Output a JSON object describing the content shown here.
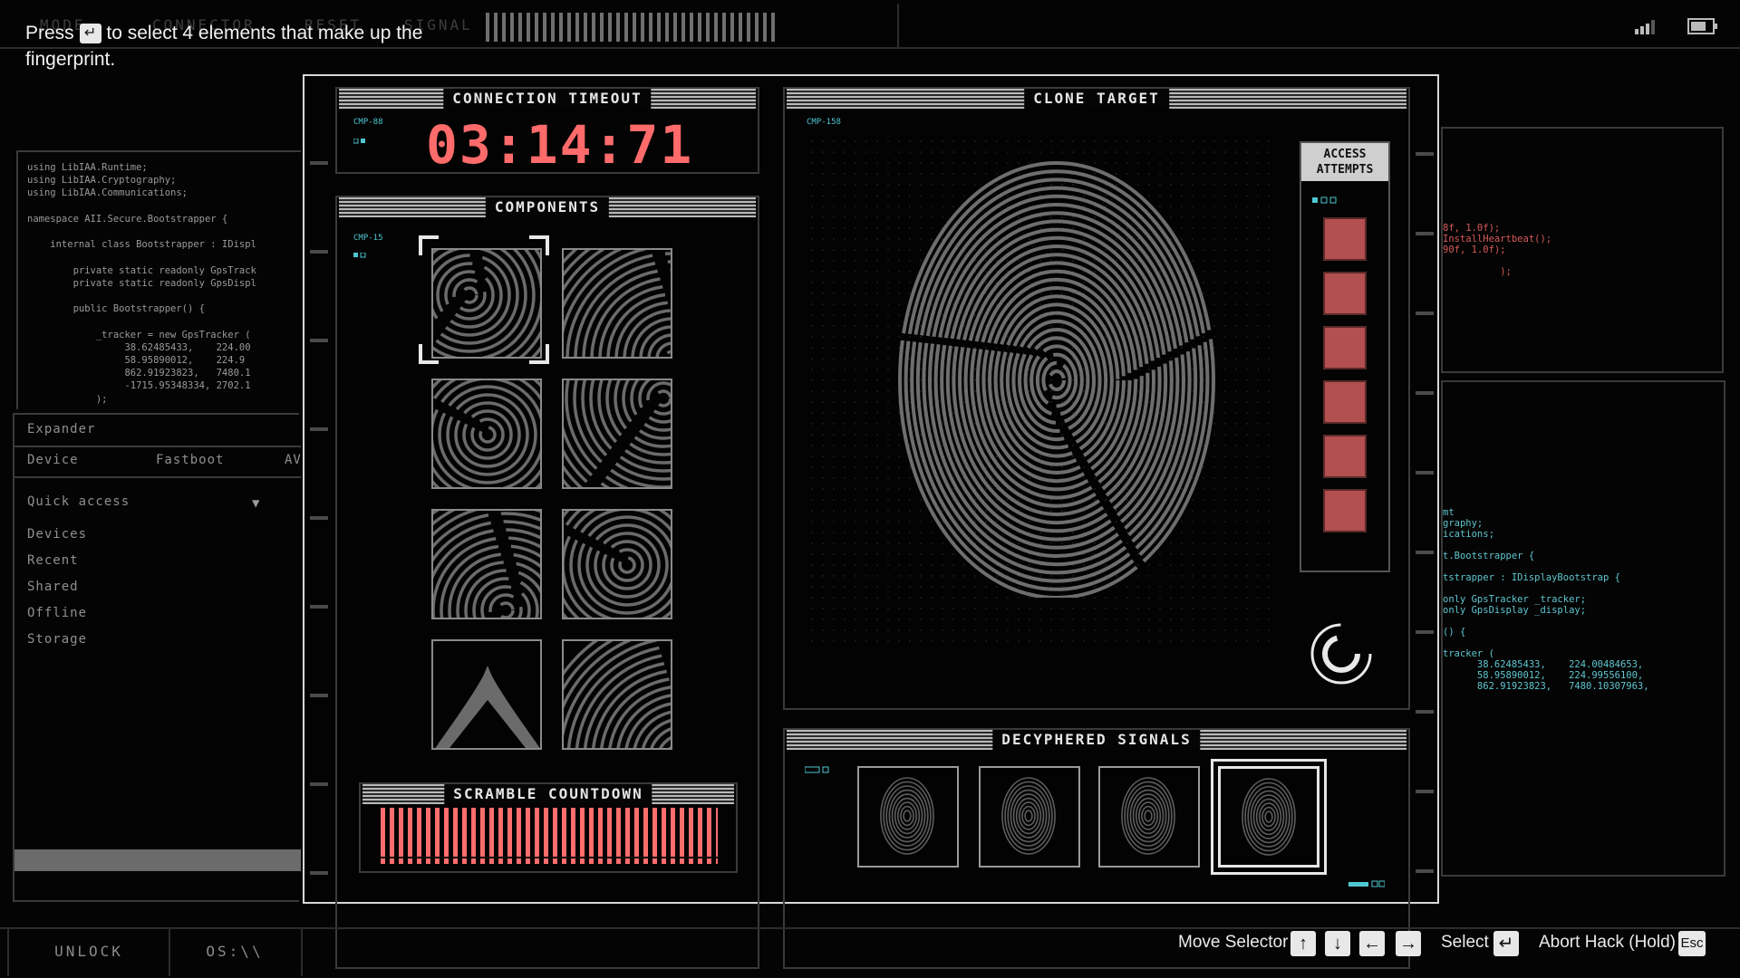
{
  "hint": {
    "prefix": "Press",
    "suffix": "to select 4 elements that make up the fingerprint."
  },
  "top_tabs": [
    "MODE",
    "CONNECTOR",
    "RESET",
    "SIGNAL"
  ],
  "code_left": "using LibIAA.Runtime;\nusing LibIAA.Cryptography;\nusing LibIAA.Communications;\n\nnamespace AII.Secure.Bootstrapper {\n\n    internal class Bootstrapper : IDispl\n\n        private static readonly GpsTrack\n        private static readonly GpsDispl\n\n        public Bootstrapper() {\n\n            _tracker = new GpsTracker (\n                 38.62485433,    224.00\n                 58.95890012,    224.9\n                 862.91923823,   7480.1\n                 -1715.95348334, 2702.1\n            );",
  "explorer": {
    "title": "Expander",
    "cols": [
      "Device",
      "Fastboot",
      "AV"
    ],
    "quick_access": "Quick access",
    "items": [
      "Devices",
      "Recent",
      "Shared",
      "Offline",
      "Storage"
    ]
  },
  "code_right_top": "8f, 1.0f);\nInstallHeartbeat();\n90f, 1.0f);\n\n          );",
  "code_right_bottom": "mt\ngraphy;\nications;\n\nt.Bootstrapper {\n\ntstrapper : IDisplayBootstrap {\n\nonly GpsTracker _tracker;\nonly GpsDisplay _display;\n\n() {\n\ntracker (\n      38.62485433,    224.00484653,\n      58.95890012,    224.99556100,\n      862.91923823,   7480.10307963,",
  "connection": {
    "title": "CONNECTION TIMEOUT",
    "tag": "CMP-88",
    "timer": "03:14:71"
  },
  "components": {
    "title": "COMPONENTS",
    "tag": "CMP-15"
  },
  "scramble": {
    "title": "SCRAMBLE COUNTDOWN",
    "progress": 1.0
  },
  "clone": {
    "title": "CLONE TARGET",
    "tag": "CMP-158"
  },
  "access": {
    "title_line1": "ACCESS",
    "title_line2": "ATTEMPTS",
    "remaining": 6
  },
  "decyphered": {
    "title": "DECYPHERED SIGNALS",
    "selected_index": 3
  },
  "bottom_tabs": [
    "UNLOCK",
    "OS:\\\\"
  ],
  "controls": {
    "move": "Move Selector",
    "select": "Select",
    "abort": "Abort Hack (Hold)",
    "esc": "Esc"
  },
  "colors": {
    "accent_red": "#ff6b6b",
    "attempt_red": "#b24f4f",
    "cyan": "#4fc7d1",
    "frame": "#d8d8d8"
  }
}
